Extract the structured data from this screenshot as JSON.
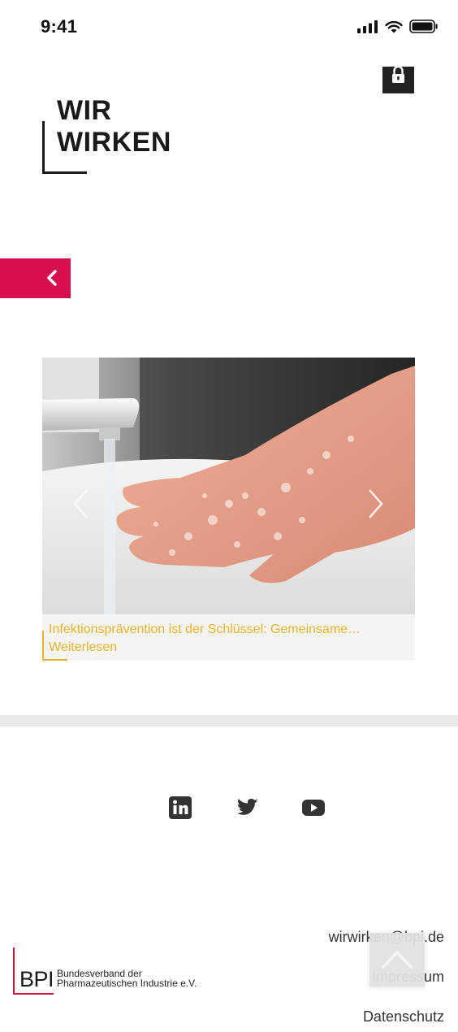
{
  "status_bar": {
    "time": "9:41",
    "icons": [
      "cellular-signal-icon",
      "wifi-icon",
      "battery-icon"
    ]
  },
  "header": {
    "lock_icon": "lock-icon",
    "logo": {
      "line1": "WIR",
      "line2": "WIRKEN"
    }
  },
  "nav": {
    "back_icon": "chevron-left-icon"
  },
  "slider": {
    "image": "hands-washing-with-soap",
    "caption_title": "Infektionsprävention ist der Schlüssel: Gemeinsame…",
    "read_more": "Weiterlesen",
    "prev_icon": "chevron-left-icon",
    "next_icon": "chevron-right-icon"
  },
  "social": [
    "linkedin-icon",
    "twitter-icon",
    "youtube-icon"
  ],
  "footer": {
    "bpi_letters": "BPI",
    "bpi_name_line1": "Bundesverband der",
    "bpi_name_line2": "Pharmazeutischen Industrie e.V.",
    "email": "wirwirken@bpi.de",
    "impressum": "Impressum",
    "datenschutz": "Datenschutz",
    "scroll_top_icon": "chevron-up-icon"
  },
  "colors": {
    "accent_red": "#d6104f",
    "caption_gold": "#e8b52a",
    "bpi_red": "#c4173a",
    "divider_gray": "#e9e9e9"
  }
}
